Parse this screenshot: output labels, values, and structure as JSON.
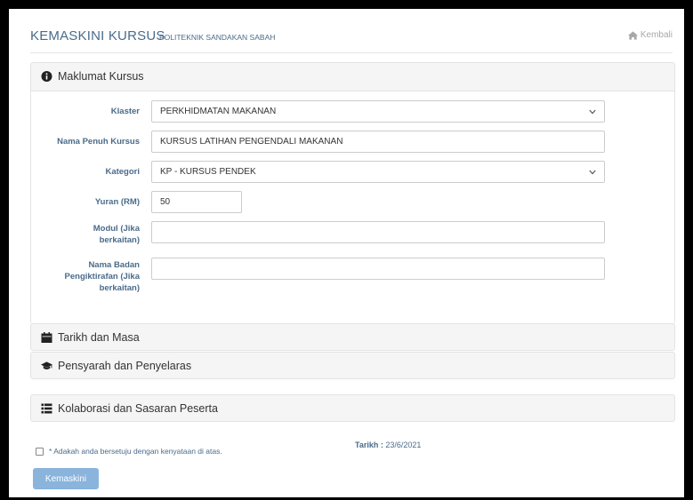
{
  "header": {
    "title": "KEMASKINI KURSUS",
    "subtitle": "POLITEKNIK SANDAKAN SABAH",
    "back_label": "Kembali"
  },
  "sections": {
    "maklumat": "Maklumat Kursus",
    "tarikh": "Tarikh dan Masa",
    "pensyarah": "Pensyarah dan Penyelaras",
    "kolaborasi": "Kolaborasi dan Sasaran Peserta"
  },
  "form": {
    "klaster": {
      "label": "Klaster",
      "value": "PERKHIDMATAN MAKANAN"
    },
    "nama": {
      "label": "Nama Penuh Kursus",
      "value": "KURSUS LATIHAN PENGENDALI MAKANAN"
    },
    "kategori": {
      "label": "Kategori",
      "value": "KP - KURSUS PENDEK"
    },
    "yuran": {
      "label": "Yuran (RM)",
      "value": "50"
    },
    "modul": {
      "label_1": "Modul (Jika",
      "label_2": "berkaitan)",
      "value": ""
    },
    "badan": {
      "label_1": "Nama Badan",
      "label_2": "Pengiktirafan (Jika",
      "label_3": "berkaitan)",
      "value": ""
    }
  },
  "footer": {
    "agree_text": "* Adakah anda bersetuju dengan kenyataan di atas.",
    "tarikh_label": "Tarikh :",
    "tarikh_value": "23/6/2021",
    "submit_label": "Kemaskini"
  },
  "icons": {
    "info": "info-circle-icon",
    "calendar": "calendar-icon",
    "graduation": "graduation-cap-icon",
    "list": "list-icon",
    "home": "home-icon"
  },
  "colors": {
    "label": "#4a6b8a",
    "button": "#8ab4dc"
  }
}
